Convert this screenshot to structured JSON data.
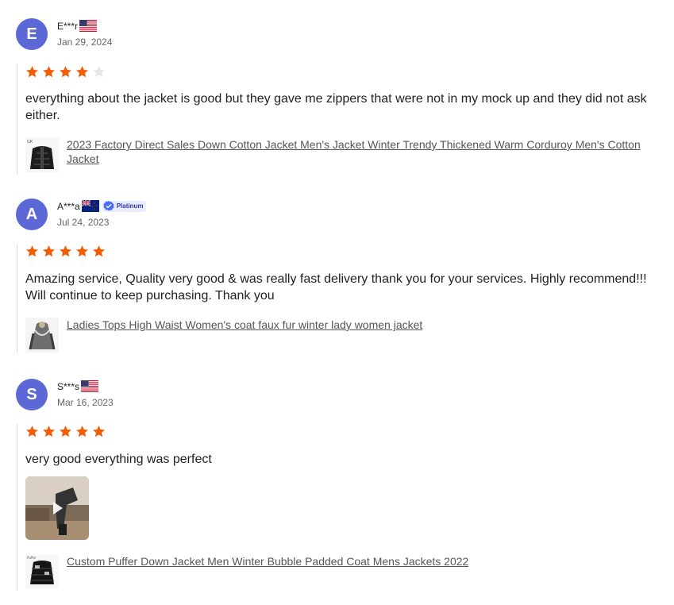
{
  "reviews": [
    {
      "avatar_letter": "E",
      "name": "E***r",
      "flag": "us-flag",
      "date": "Jan 29, 2024",
      "rating": 4,
      "text": "everything about the jacket is good but they gave me zippers that were not in my mock up and they did not ask either.",
      "product": "2023 Factory Direct Sales Down Cotton Jacket Men's Jacket Winter Trendy Thickened Warm Corduroy Men's Cotton Jacket"
    },
    {
      "avatar_letter": "A",
      "name": "A***a",
      "flag": "nz-flag",
      "badge": "Platinum",
      "date": "Jul 24, 2023",
      "rating": 5,
      "text": "Amazing service, Quality very good & was really fast delivery thank you for your services. Highly recommend!!! Will continue to keep purchasing. Thank you",
      "product": "Ladies Tops High Waist Women's coat faux fur winter lady women jacket"
    },
    {
      "avatar_letter": "S",
      "name": "S***s",
      "flag": "us-flag",
      "date": "Mar 16, 2023",
      "rating": 5,
      "text": "very good everything was perfect",
      "has_video": true,
      "product": "Custom Puffer Down Jacket Men Winter Bubble Padded Coat Mens Jackets 2022"
    }
  ],
  "colors": {
    "avatar": "#5b68d6",
    "star_filled": "#f25c05",
    "star_empty": "#e6e6e6",
    "badge_text": "#2d3aa8"
  }
}
